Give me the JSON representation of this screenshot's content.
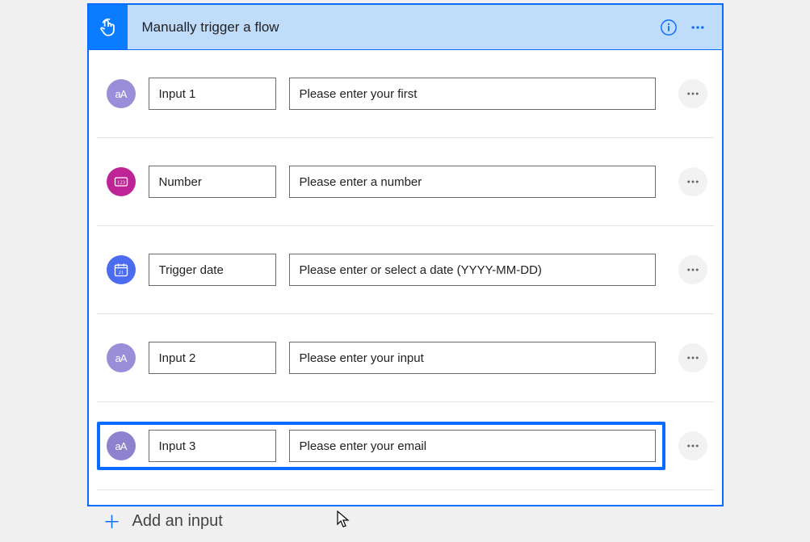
{
  "header": {
    "title": "Manually trigger a flow"
  },
  "inputs": [
    {
      "icon": "text",
      "icon_label": "aA",
      "name": "Input 1",
      "placeholder": "Please enter your first",
      "selected": false
    },
    {
      "icon": "number",
      "icon_label": "123",
      "name": "Number",
      "placeholder": "Please enter a number",
      "selected": false
    },
    {
      "icon": "date",
      "icon_label": "",
      "name": "Trigger date",
      "placeholder": "Please enter or select a date (YYYY-MM-DD)",
      "selected": false
    },
    {
      "icon": "text",
      "icon_label": "aA",
      "name": "Input 2",
      "placeholder": "Please enter your input",
      "selected": false
    },
    {
      "icon": "text2",
      "icon_label": "aA",
      "name": "Input 3",
      "placeholder": "Please enter your email",
      "selected": true
    }
  ],
  "footer": {
    "add_label": "Add an input"
  }
}
